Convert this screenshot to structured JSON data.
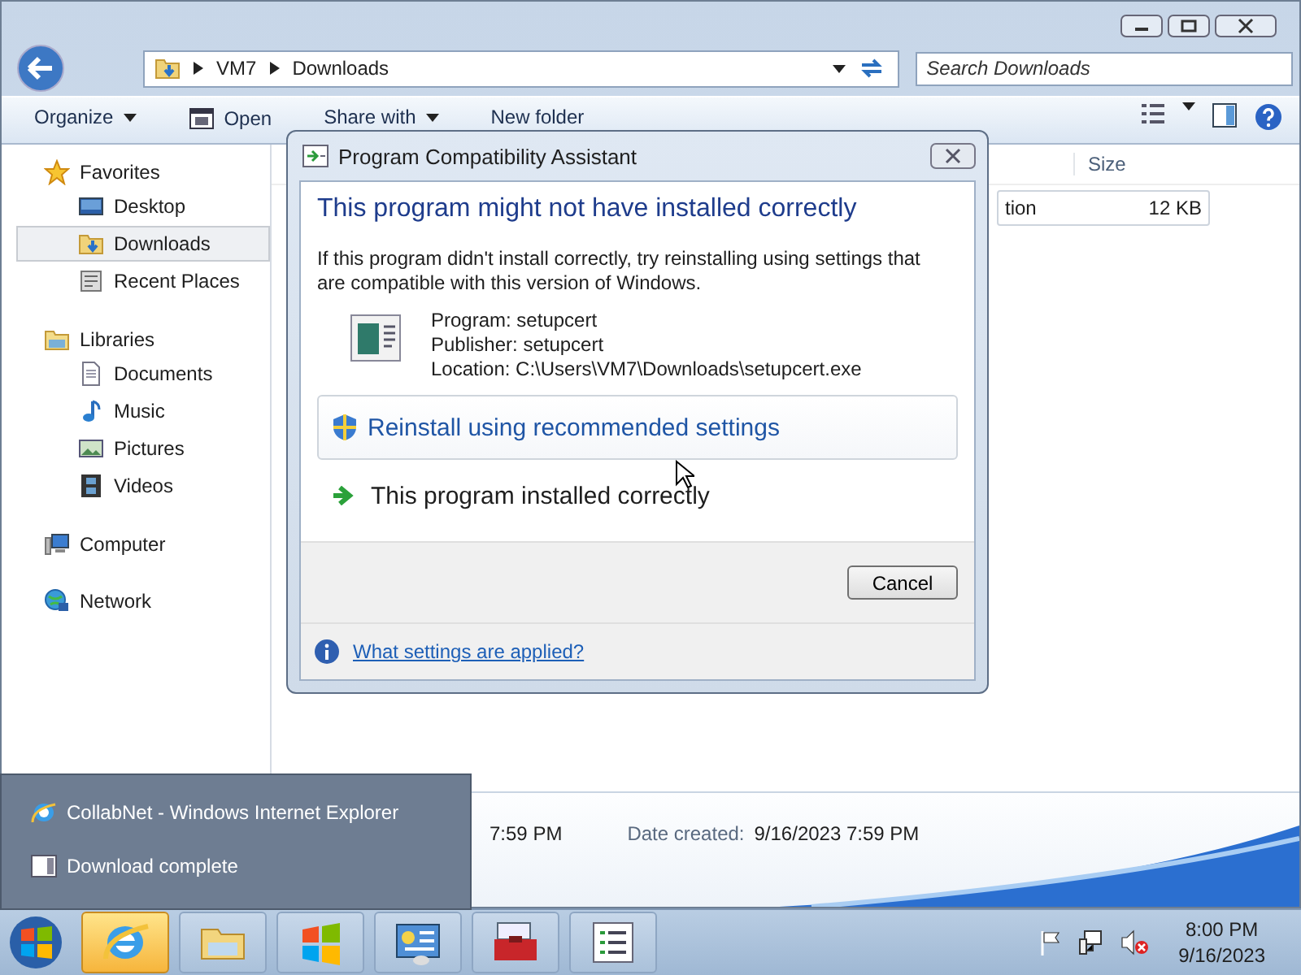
{
  "explorer": {
    "address": [
      "VM7",
      "Downloads"
    ],
    "search": {
      "placeholder": "Search Downloads"
    },
    "toolbar": [
      {
        "label": "Organize",
        "kind": "menu"
      },
      {
        "label": "Open",
        "kind": "open"
      },
      {
        "label": "Share with",
        "kind": "menu"
      },
      {
        "label": "New folder",
        "kind": "plain"
      }
    ],
    "sidebar": [
      {
        "label": "Favorites",
        "kind": "star",
        "children": [
          {
            "label": "Desktop",
            "kind": "desktop",
            "selected": false
          },
          {
            "label": "Downloads",
            "kind": "downloads",
            "selected": true
          },
          {
            "label": "Recent Places",
            "kind": "recent",
            "selected": false
          }
        ]
      },
      {
        "label": "Libraries",
        "kind": "libraries",
        "children": [
          {
            "label": "Documents",
            "kind": "documents",
            "selected": false
          },
          {
            "label": "Music",
            "kind": "music",
            "selected": false
          },
          {
            "label": "Pictures",
            "kind": "pictures",
            "selected": false
          },
          {
            "label": "Videos",
            "kind": "videos",
            "selected": false
          }
        ]
      },
      {
        "label": "Computer",
        "kind": "computer"
      },
      {
        "label": "Network",
        "kind": "network"
      }
    ],
    "columns": [
      {
        "label": "Size"
      }
    ],
    "rows": [
      {
        "cells": [
          "tion",
          "12 KB"
        ]
      }
    ],
    "details": [
      {
        "value": "7:59 PM"
      },
      {
        "label": "Date created:",
        "value": "9/16/2023 7:59 PM"
      }
    ]
  },
  "dialog": {
    "title": "Program Compatibility Assistant",
    "heading": "This program might not have installed correctly",
    "message": "If this program didn't install correctly, try reinstalling using settings that are compatible with this version of Windows.",
    "program_info": [
      "Program: setupcert",
      "Publisher: setupcert",
      "Location: C:\\Users\\VM7\\Downloads\\setupcert.exe"
    ],
    "options": [
      {
        "label": "Reinstall using recommended settings",
        "kind": "shield",
        "hovered": true
      },
      {
        "label": "This program installed correctly",
        "kind": "arrow",
        "hovered": false
      }
    ],
    "buttons": [
      "Cancel"
    ],
    "footer_link": "What settings are applied?"
  },
  "notification": [
    {
      "label": "CollabNet - Windows Internet Explorer",
      "kind": "ie"
    },
    {
      "label": "Download complete",
      "kind": "window"
    }
  ],
  "taskbar": {
    "buttons": [
      {
        "kind": "ie",
        "active": true
      },
      {
        "kind": "explorer",
        "active": false
      },
      {
        "kind": "windows",
        "active": false
      },
      {
        "kind": "control-panel",
        "active": false
      },
      {
        "kind": "toolbox",
        "active": false
      },
      {
        "kind": "list",
        "active": false
      }
    ],
    "time": "8:00 PM",
    "date": "9/16/2023"
  }
}
